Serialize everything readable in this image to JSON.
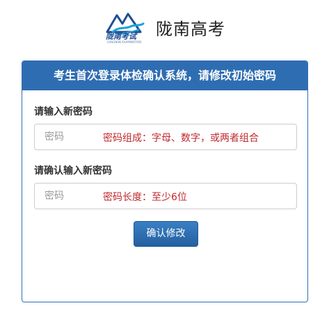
{
  "header": {
    "logo_text": "陇南考试",
    "logo_subtext": "LONGNAN EXAMINATION",
    "site_title": "陇南高考"
  },
  "panel": {
    "title": "考生首次登录体检确认系统，请修改初始密码"
  },
  "form": {
    "new_password": {
      "label": "请输入新密码",
      "placeholder": "密码",
      "value": "",
      "hint": "密码组成：字母、数字，或两者组合"
    },
    "confirm_password": {
      "label": "请确认输入新密码",
      "placeholder": "密码",
      "value": "",
      "hint": "密码长度：至少6位"
    },
    "submit_label": "确认修改"
  },
  "colors": {
    "accent": "#2f6db3",
    "hint_red": "#c0282d",
    "logo_blue": "#1e4f96",
    "logo_cyan": "#1aa3d6"
  }
}
